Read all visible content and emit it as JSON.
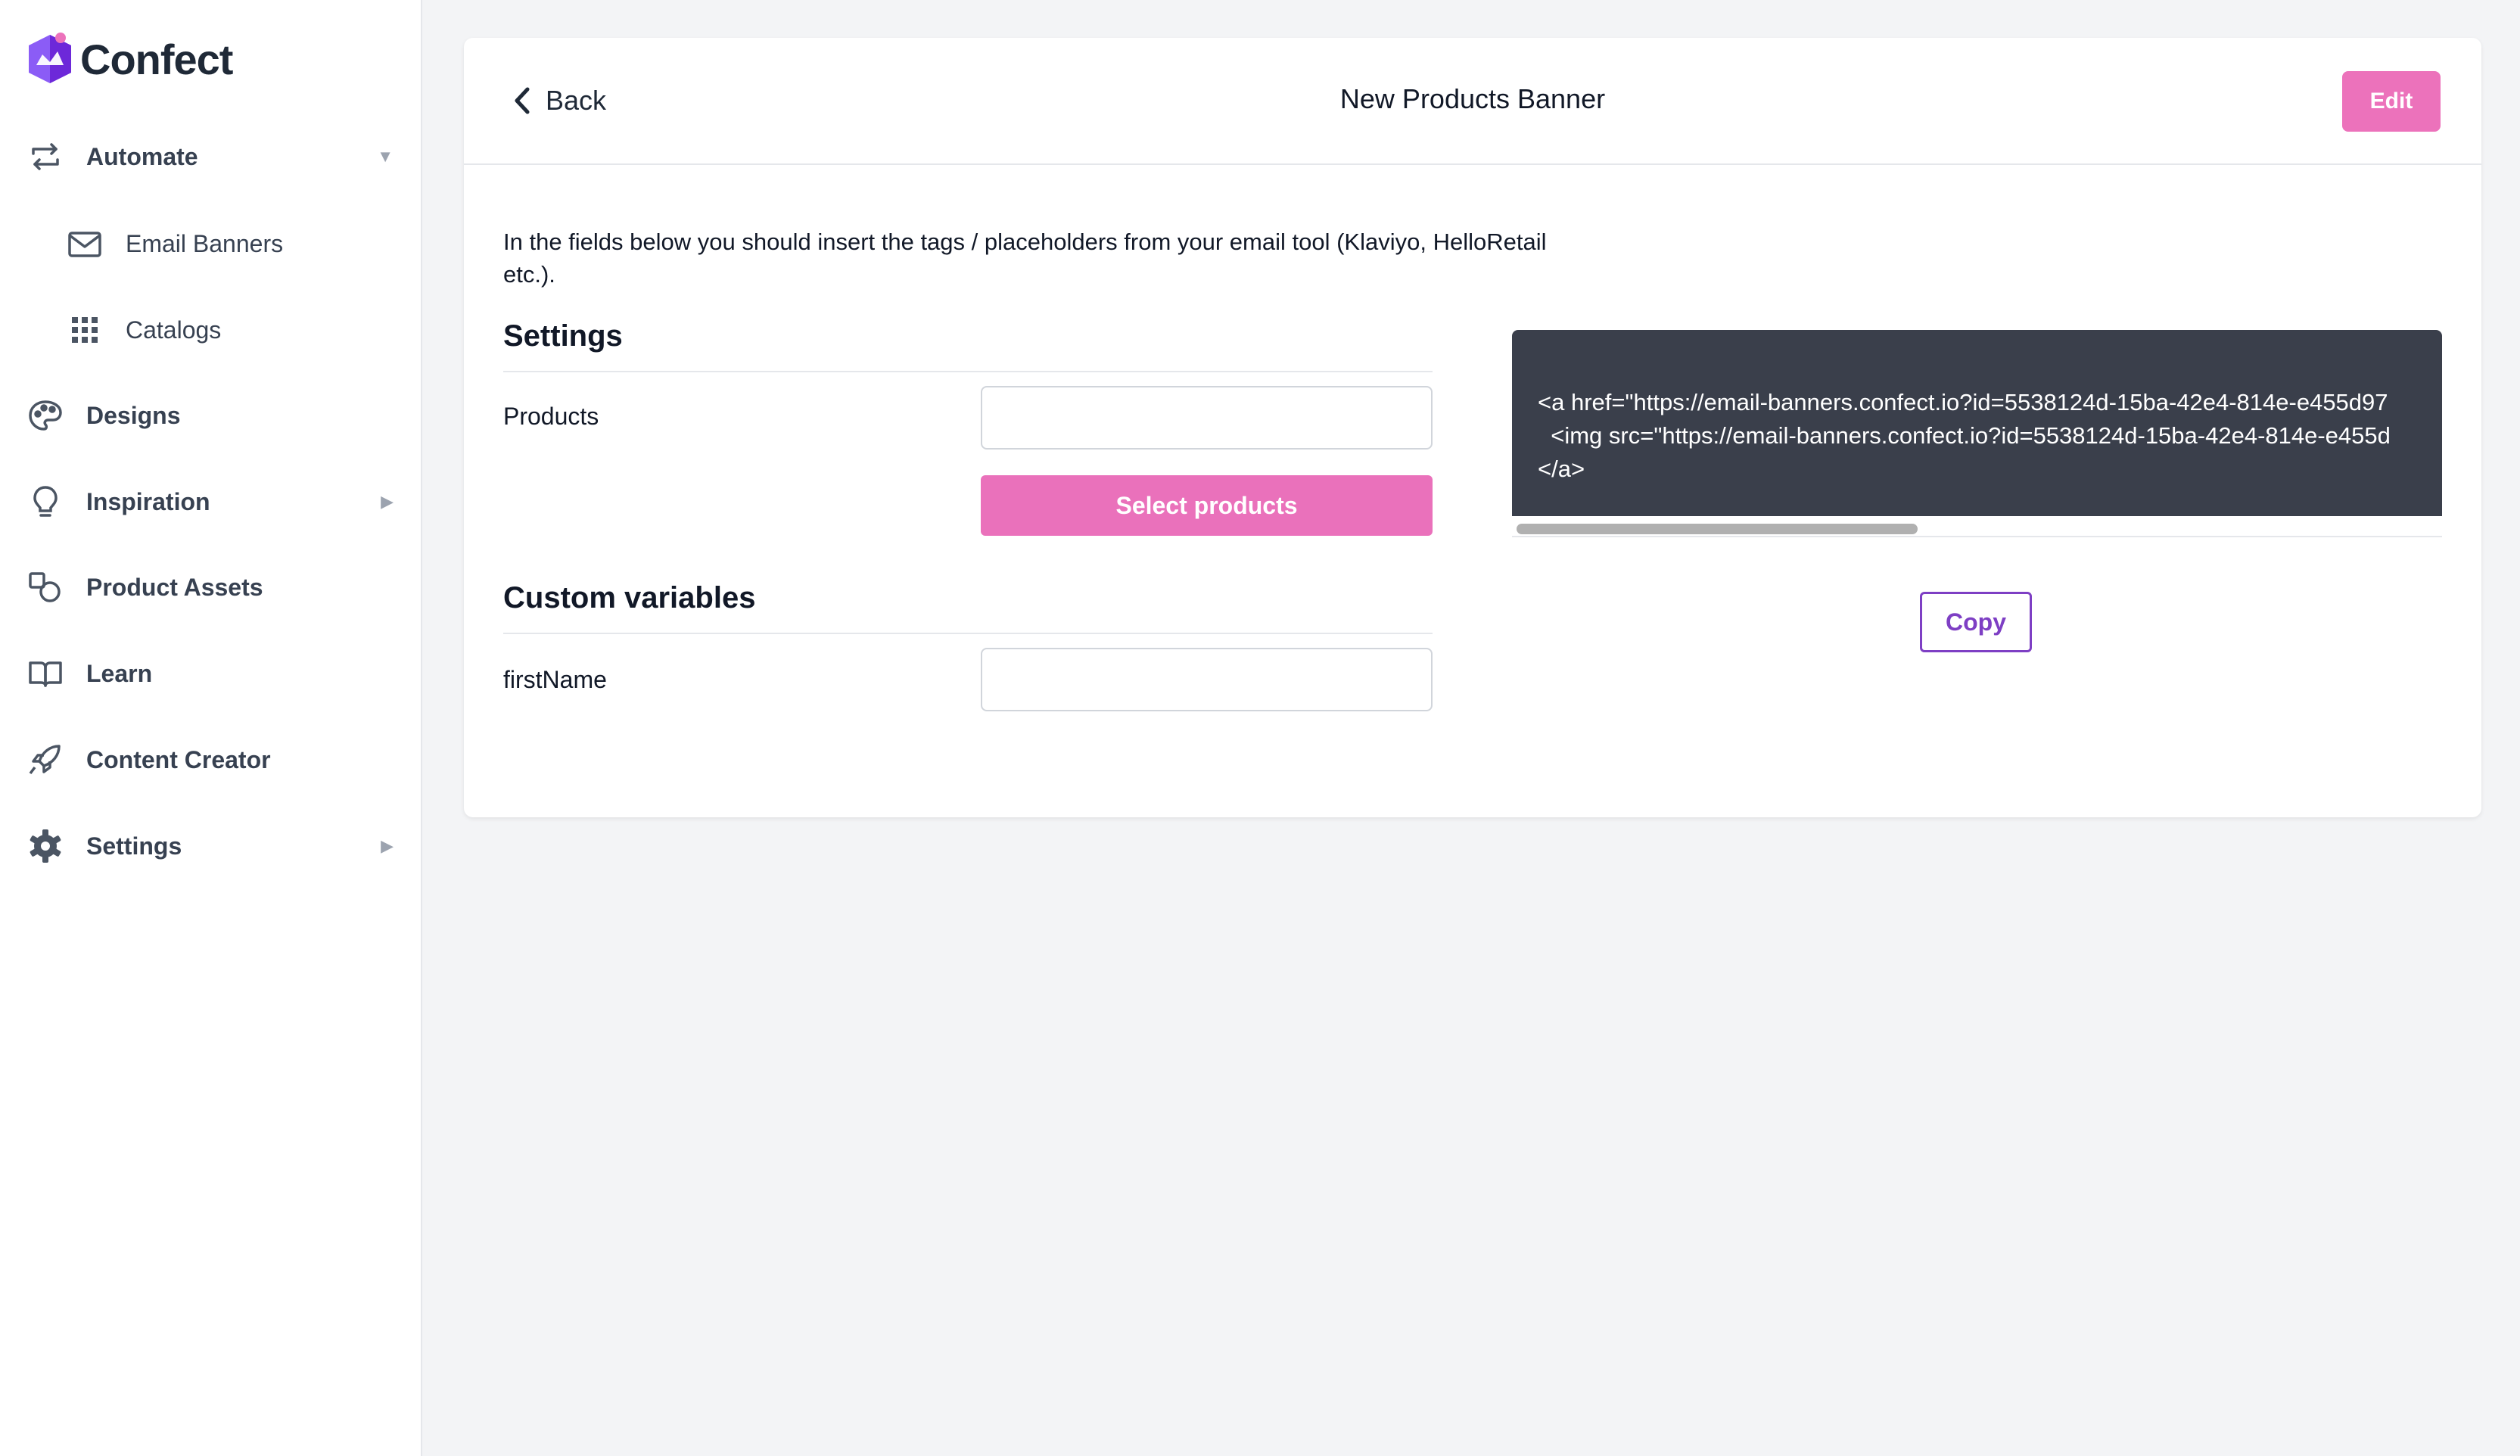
{
  "brand": {
    "name": "Confect"
  },
  "sidebar": {
    "items": [
      {
        "label": "Automate",
        "icon": "repeat-icon",
        "caret": "▼"
      },
      {
        "label": "Email Banners",
        "icon": "mail-icon"
      },
      {
        "label": "Catalogs",
        "icon": "grid-icon"
      },
      {
        "label": "Designs",
        "icon": "palette-icon"
      },
      {
        "label": "Inspiration",
        "icon": "lightbulb-icon",
        "caret": "▶"
      },
      {
        "label": "Product Assets",
        "icon": "shapes-icon"
      },
      {
        "label": "Learn",
        "icon": "book-icon"
      },
      {
        "label": "Content Creator",
        "icon": "rocket-icon"
      },
      {
        "label": "Settings",
        "icon": "gear-icon",
        "caret": "▶"
      }
    ]
  },
  "header": {
    "back_label": "Back",
    "title": "New Products Banner",
    "edit_label": "Edit"
  },
  "main": {
    "intro": "In the fields below you should insert the tags / placeholders from your email tool (Klaviyo, HelloRetail etc.).",
    "settings_title": "Settings",
    "products_label": "Products",
    "products_value": "",
    "select_products_label": "Select products",
    "custom_variables_title": "Custom variables",
    "firstname_label": "firstName",
    "firstname_value": ""
  },
  "code": {
    "line1": "<a href=\"https://email-banners.confect.io?id=5538124d-15ba-42e4-814e-e455d97",
    "line2": "  <img src=\"https://email-banners.confect.io?id=5538124d-15ba-42e4-814e-e455d",
    "line3": "</a>",
    "copy_label": "Copy"
  },
  "colors": {
    "accent_pink": "#ea71bb",
    "accent_purple": "#7e3fc4",
    "code_bg": "#3a3f4b"
  }
}
